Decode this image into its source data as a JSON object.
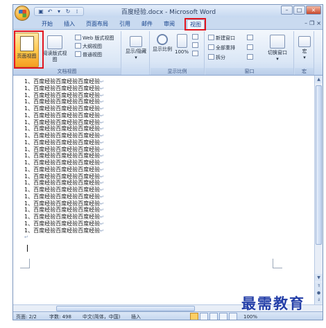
{
  "window": {
    "title": "百度经验.docx - Microsoft Word",
    "controls": [
      "–",
      "□",
      "×"
    ]
  },
  "tabs": [
    {
      "label": "开始"
    },
    {
      "label": "插入"
    },
    {
      "label": "页面布局"
    },
    {
      "label": "引用"
    },
    {
      "label": "邮件"
    },
    {
      "label": "审阅"
    },
    {
      "label": "视图"
    }
  ],
  "ribbon": {
    "doc_views": {
      "label": "文档视图",
      "print_layout": "页面视图",
      "full_screen_reading": "阅读版式视图",
      "web_layout": "Web 版式视图",
      "outline": "大纲视图",
      "draft": "普通视图"
    },
    "show_hide": {
      "label": "显示/隐藏"
    },
    "zoom": {
      "label": "显示比例",
      "zoom_btn": "显示比例",
      "hundred": "100%"
    },
    "window": {
      "label": "窗口",
      "new_window": "新建窗口",
      "arrange_all": "全部重排",
      "split": "拆分",
      "switch_windows": "切换窗口"
    },
    "macros": {
      "label": "宏",
      "btn": "宏"
    }
  },
  "document": {
    "lines": [
      "1、百度经验百度经验百度经验",
      "1、百度经验百度经验百度经验",
      "1、百度经验百度经验百度经验",
      "1、百度经验百度经验百度经验",
      "1、百度经验百度经验百度经验",
      "1、百度经验百度经验百度经验",
      "1、百度经验百度经验百度经验",
      "1、百度经验百度经验百度经验",
      "1、百度经验百度经验百度经验",
      "1、百度经验百度经验百度经验",
      "1、百度经验百度经验百度经验",
      "1、百度经验百度经验百度经验",
      "1、百度经验百度经验百度经验",
      "1、百度经验百度经验百度经验",
      "1、百度经验百度经验百度经验",
      "1、百度经验百度经验百度经验",
      "1、百度经验百度经验百度经验",
      "1、百度经验百度经验百度经验",
      "1、百度经验百度经验百度经验",
      "1、百度经验百度经验百度经验",
      "1、百度经验百度经验百度经验",
      "1、百度经验百度经验百度经验",
      "1、百度经验百度经验百度经验"
    ],
    "paragraph_mark": "↵"
  },
  "status": {
    "page": "页面: 2/2",
    "words": "字数: 498",
    "language": "中文(简体，中国)",
    "insert": "插入",
    "zoom": "100%"
  },
  "watermark": "最需教育",
  "colors": {
    "highlight_red": "#e1141e",
    "active_orange": "#ffc64a",
    "watermark_blue": "#243fa8"
  }
}
